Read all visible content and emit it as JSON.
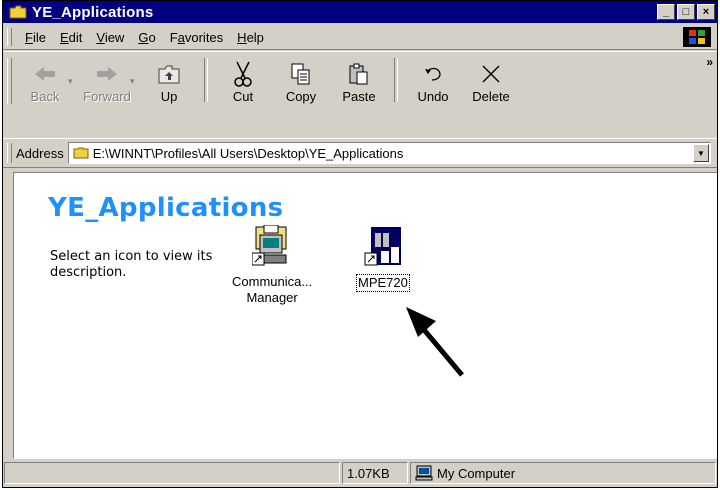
{
  "window": {
    "title": "YE_Applications",
    "caption_buttons": {
      "minimize": "_",
      "maximize": "□",
      "close": "×"
    }
  },
  "menu": [
    {
      "label": "File",
      "hotkey": "F"
    },
    {
      "label": "Edit",
      "hotkey": "E"
    },
    {
      "label": "View",
      "hotkey": "V"
    },
    {
      "label": "Go",
      "hotkey": "G"
    },
    {
      "label": "Favorites",
      "hotkey": "a"
    },
    {
      "label": "Help",
      "hotkey": "H"
    }
  ],
  "toolbar": {
    "back": "Back",
    "forward": "Forward",
    "up": "Up",
    "cut": "Cut",
    "copy": "Copy",
    "paste": "Paste",
    "undo": "Undo",
    "delete": "Delete",
    "more": "»"
  },
  "address": {
    "label": "Address",
    "path": "E:\\WINNT\\Profiles\\All Users\\Desktop\\YE_Applications"
  },
  "content": {
    "heading": "YE_Applications",
    "description": "Select an icon to view its description.",
    "icons": [
      {
        "label_line1": "Communica...",
        "label_line2": "Manager",
        "icon": "communication-manager-icon"
      },
      {
        "label_line1": "MPE720",
        "icon": "mpe720-icon",
        "selected": true
      }
    ]
  },
  "statusbar": {
    "size": "1.07KB",
    "zone": "My Computer"
  },
  "colors": {
    "titlebar": "#000080",
    "heading": "#1e90ff",
    "face": "#d4d0c8"
  }
}
